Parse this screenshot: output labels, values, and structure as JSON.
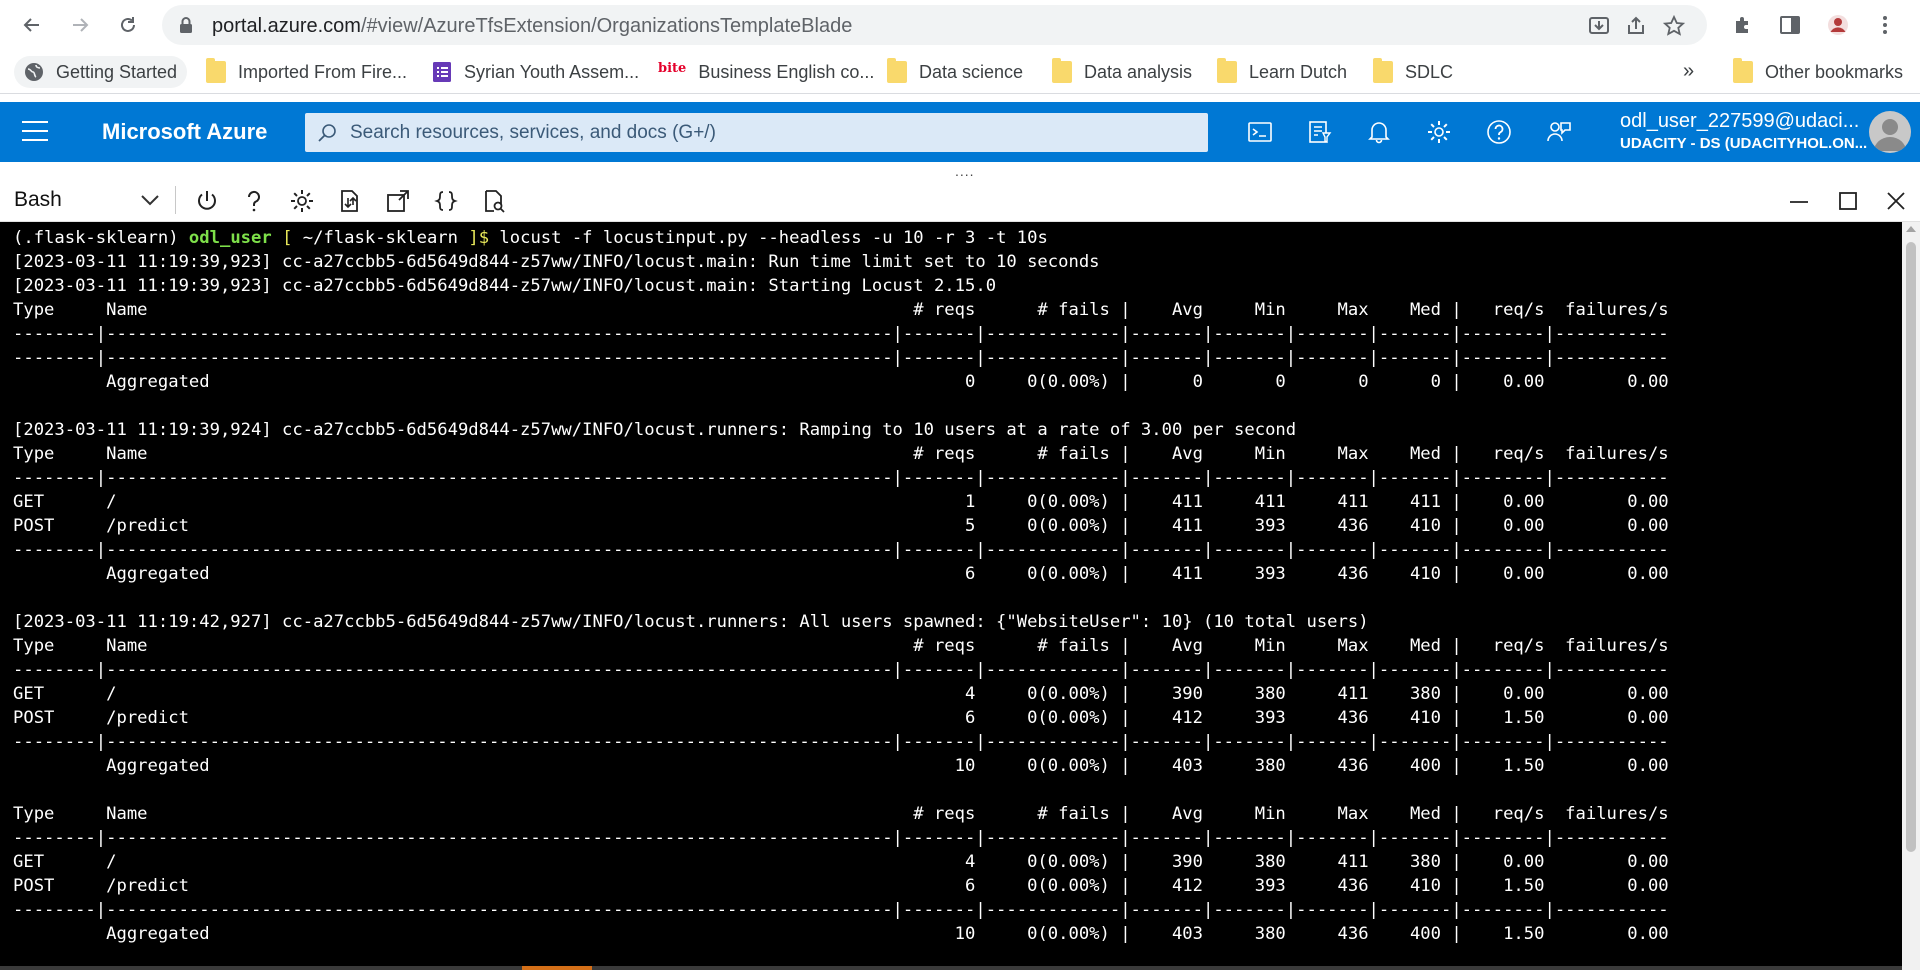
{
  "browser": {
    "url_host": "portal.azure.com",
    "url_path": "/#view/AzureTfsExtension/OrganizationsTemplateBlade"
  },
  "bookmarks": {
    "items": [
      {
        "label": "Getting Started",
        "icon": "globe-icon"
      },
      {
        "label": "Imported From Fire...",
        "icon": "folder-icon"
      },
      {
        "label": "Syrian Youth Assem...",
        "icon": "forms-icon"
      },
      {
        "label": "Business English co...",
        "icon": "bite-icon",
        "icon_text": "bite"
      },
      {
        "label": "Data science",
        "icon": "folder-icon"
      },
      {
        "label": "Data analysis",
        "icon": "folder-icon"
      },
      {
        "label": "Learn Dutch",
        "icon": "folder-icon"
      },
      {
        "label": "SDLC",
        "icon": "folder-icon"
      }
    ],
    "overflow": "»",
    "other": "Other bookmarks"
  },
  "azure": {
    "brand": "Microsoft Azure",
    "search_placeholder": "Search resources, services, and docs (G+/)",
    "user_name": "odl_user_227599@udaci...",
    "user_org": "UDACITY - DS (UDACITYHOL.ON..."
  },
  "shell": {
    "type": "Bash",
    "splitter_grip": "...."
  },
  "terminal": {
    "prompt": {
      "env": "(.flask-sklearn) ",
      "user": "odl_user",
      "open": " [ ",
      "path": "~/flask-sklearn",
      "close": " ]",
      "dollar": "$",
      "command": " locust -f locustinput.py --headless -u 10 -r 3 -t 10s"
    },
    "lines": [
      "[2023-03-11 11:19:39,923] cc-a27ccbb5-6d5649d844-z57ww/INFO/locust.main: Run time limit set to 10 seconds",
      "[2023-03-11 11:19:39,923] cc-a27ccbb5-6d5649d844-z57ww/INFO/locust.main: Starting Locust 2.15.0",
      "Type     Name                                                                          # reqs      # fails |    Avg     Min     Max    Med |   req/s  failures/s",
      "--------|----------------------------------------------------------------------------|-------|-------------|-------|-------|-------|-------|--------|-----------",
      "--------|----------------------------------------------------------------------------|-------|-------------|-------|-------|-------|-------|--------|-----------",
      "         Aggregated                                                                         0     0(0.00%) |      0       0       0      0 |    0.00        0.00",
      "",
      "[2023-03-11 11:19:39,924] cc-a27ccbb5-6d5649d844-z57ww/INFO/locust.runners: Ramping to 10 users at a rate of 3.00 per second",
      "Type     Name                                                                          # reqs      # fails |    Avg     Min     Max    Med |   req/s  failures/s",
      "--------|----------------------------------------------------------------------------|-------|-------------|-------|-------|-------|-------|--------|-----------",
      "GET      /                                                                                  1     0(0.00%) |    411     411     411    411 |    0.00        0.00",
      "POST     /predict                                                                           5     0(0.00%) |    411     393     436    410 |    0.00        0.00",
      "--------|----------------------------------------------------------------------------|-------|-------------|-------|-------|-------|-------|--------|-----------",
      "         Aggregated                                                                         6     0(0.00%) |    411     393     436    410 |    0.00        0.00",
      "",
      "[2023-03-11 11:19:42,927] cc-a27ccbb5-6d5649d844-z57ww/INFO/locust.runners: All users spawned: {\"WebsiteUser\": 10} (10 total users)",
      "Type     Name                                                                          # reqs      # fails |    Avg     Min     Max    Med |   req/s  failures/s",
      "--------|----------------------------------------------------------------------------|-------|-------------|-------|-------|-------|-------|--------|-----------",
      "GET      /                                                                                  4     0(0.00%) |    390     380     411    380 |    0.00        0.00",
      "POST     /predict                                                                           6     0(0.00%) |    412     393     436    410 |    1.50        0.00",
      "--------|----------------------------------------------------------------------------|-------|-------------|-------|-------|-------|-------|--------|-----------",
      "         Aggregated                                                                        10     0(0.00%) |    403     380     436    400 |    1.50        0.00",
      "",
      "Type     Name                                                                          # reqs      # fails |    Avg     Min     Max    Med |   req/s  failures/s",
      "--------|----------------------------------------------------------------------------|-------|-------------|-------|-------|-------|-------|--------|-----------",
      "GET      /                                                                                  4     0(0.00%) |    390     380     411    380 |    0.00        0.00",
      "POST     /predict                                                                           6     0(0.00%) |    412     393     436    410 |    1.50        0.00",
      "--------|----------------------------------------------------------------------------|-------|-------------|-------|-------|-------|-------|--------|-----------",
      "         Aggregated                                                                        10     0(0.00%) |    403     380     436    400 |    1.50        0.00"
    ]
  },
  "colors": {
    "azure_blue": "#0078d4",
    "terminal_bg": "#000000",
    "prompt_user": "#7ee04a",
    "prompt_bracket": "#e8e85a"
  }
}
